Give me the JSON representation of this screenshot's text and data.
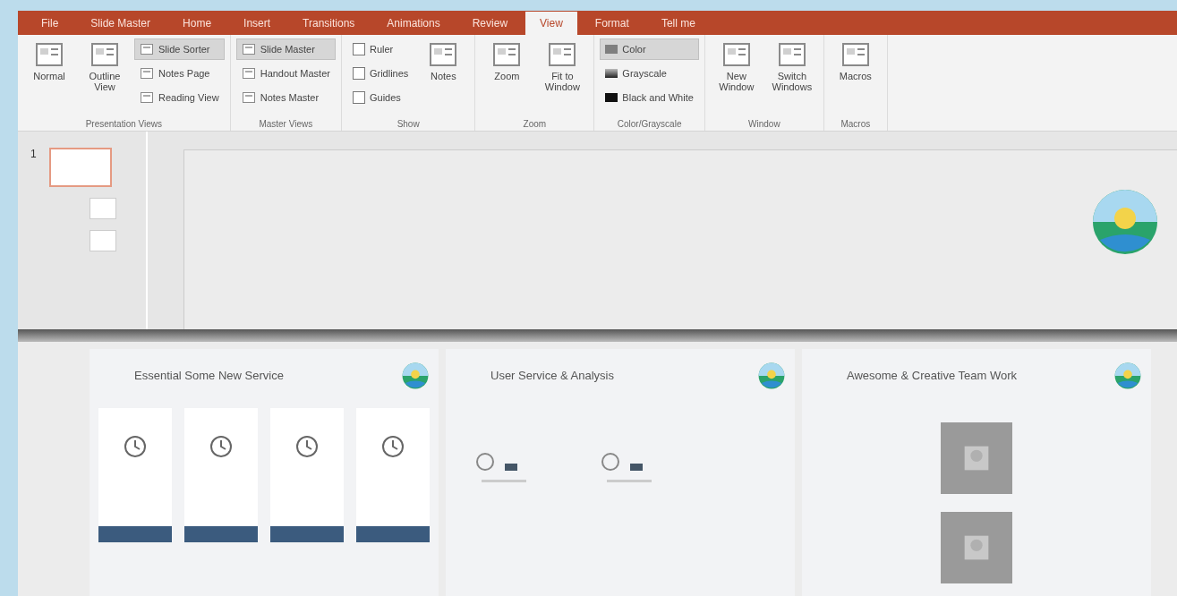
{
  "tabs": [
    {
      "label": "File",
      "selected": false
    },
    {
      "label": "Slide Master",
      "selected": false
    },
    {
      "label": "Home",
      "selected": false
    },
    {
      "label": "Insert",
      "selected": false
    },
    {
      "label": "Transitions",
      "selected": false
    },
    {
      "label": "Animations",
      "selected": false
    },
    {
      "label": "Review",
      "selected": false
    },
    {
      "label": "View",
      "selected": true
    },
    {
      "label": "Format",
      "selected": false
    },
    {
      "label": "Tell me",
      "selected": false
    }
  ],
  "ribbon": [
    {
      "label": "Presentation Views",
      "columns": [
        [
          {
            "kind": "large",
            "label": "Normal"
          }
        ],
        [
          {
            "kind": "large",
            "label": "Outline View"
          }
        ],
        [
          {
            "kind": "small",
            "label": "Slide Sorter",
            "selected": true
          },
          {
            "kind": "small",
            "label": "Notes Page",
            "selected": false
          },
          {
            "kind": "small",
            "label": "Reading View",
            "selected": false
          }
        ]
      ]
    },
    {
      "label": "Master Views",
      "columns": [
        [
          {
            "kind": "small",
            "label": "Slide Master",
            "selected": true
          },
          {
            "kind": "small",
            "label": "Handout Master",
            "selected": false
          },
          {
            "kind": "small",
            "label": "Notes Master",
            "selected": false
          }
        ]
      ]
    },
    {
      "label": "Show",
      "columns": [
        [
          {
            "kind": "check",
            "label": "Ruler",
            "checked": false
          },
          {
            "kind": "check",
            "label": "Gridlines",
            "checked": false
          },
          {
            "kind": "check",
            "label": "Guides",
            "checked": false
          }
        ],
        [
          {
            "kind": "large",
            "label": "Notes"
          }
        ]
      ]
    },
    {
      "label": "Zoom",
      "columns": [
        [
          {
            "kind": "large",
            "label": "Zoom"
          }
        ],
        [
          {
            "kind": "large",
            "label": "Fit to Window"
          }
        ]
      ]
    },
    {
      "label": "Color/Grayscale",
      "columns": [
        [
          {
            "kind": "swatch",
            "label": "Color",
            "selected": true
          },
          {
            "kind": "swatch",
            "label": "Grayscale",
            "selected": false
          },
          {
            "kind": "swatch",
            "label": "Black and White",
            "selected": false
          }
        ]
      ]
    },
    {
      "label": "Window",
      "columns": [
        [
          {
            "kind": "large",
            "label": "New Window"
          }
        ],
        [
          {
            "kind": "large",
            "label": "Switch Windows"
          }
        ]
      ]
    },
    {
      "label": "Macros",
      "columns": [
        [
          {
            "kind": "large",
            "label": "Macros"
          }
        ]
      ]
    }
  ],
  "thumbnails": [
    {
      "number": "1",
      "selected": true
    }
  ],
  "slides": [
    {
      "title": "Essential Some New Service"
    },
    {
      "title": "User Service & Analysis"
    },
    {
      "title": "Awesome & Creative Team Work"
    }
  ]
}
